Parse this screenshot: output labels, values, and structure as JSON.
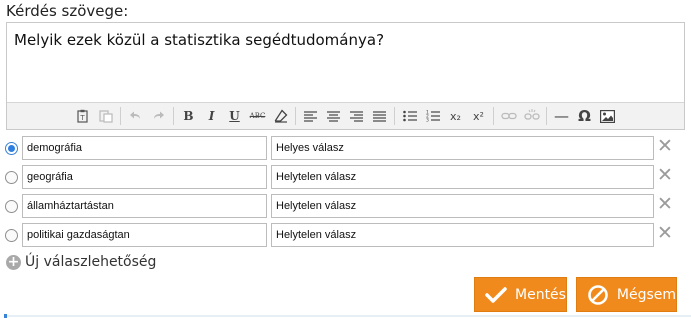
{
  "question": {
    "label": "Kérdés szövege:",
    "text": "Melyik ezek közül a statisztika segédtudománya?"
  },
  "toolbar": {
    "buttons": [
      {
        "name": "paste-text-icon",
        "glyph": "",
        "enabled": true
      },
      {
        "name": "paste-word-icon",
        "glyph": "",
        "enabled": false
      },
      {
        "name": "undo-icon",
        "glyph": "↶",
        "enabled": false
      },
      {
        "name": "redo-icon",
        "glyph": "↷",
        "enabled": false
      },
      {
        "name": "bold-icon",
        "glyph": "B",
        "enabled": true
      },
      {
        "name": "italic-icon",
        "glyph": "I",
        "enabled": true
      },
      {
        "name": "underline-icon",
        "glyph": "U",
        "enabled": true
      },
      {
        "name": "strikethrough-icon",
        "glyph": "ABC",
        "enabled": true
      },
      {
        "name": "eraser-icon",
        "glyph": "",
        "enabled": true
      },
      {
        "name": "align-left-icon",
        "glyph": "",
        "enabled": true
      },
      {
        "name": "align-center-icon",
        "glyph": "",
        "enabled": true
      },
      {
        "name": "align-right-icon",
        "glyph": "",
        "enabled": true
      },
      {
        "name": "align-justify-icon",
        "glyph": "",
        "enabled": true
      },
      {
        "name": "bullet-list-icon",
        "glyph": "",
        "enabled": true
      },
      {
        "name": "numbered-list-icon",
        "glyph": "",
        "enabled": true
      },
      {
        "name": "subscript-icon",
        "glyph": "x₂",
        "enabled": true
      },
      {
        "name": "superscript-icon",
        "glyph": "x²",
        "enabled": true
      },
      {
        "name": "link-icon",
        "glyph": "",
        "enabled": false
      },
      {
        "name": "unlink-icon",
        "glyph": "",
        "enabled": false
      },
      {
        "name": "horizontal-rule-icon",
        "glyph": "—",
        "enabled": true
      },
      {
        "name": "omega-icon",
        "glyph": "Ω",
        "enabled": true
      },
      {
        "name": "image-icon",
        "glyph": "",
        "enabled": true
      }
    ]
  },
  "answers": [
    {
      "text": "demográfia",
      "feedback": "Helyes válasz",
      "selected": true
    },
    {
      "text": "geográfia",
      "feedback": "Helytelen válasz",
      "selected": false
    },
    {
      "text": "államháztartástan",
      "feedback": "Helytelen válasz",
      "selected": false
    },
    {
      "text": "politikai gazdaságtan",
      "feedback": "Helytelen válasz",
      "selected": false
    }
  ],
  "add_option_label": "Új válaszlehetőség",
  "buttons": {
    "save_label": "Mentés",
    "cancel_label": "Mégsem"
  },
  "colors": {
    "accent": "#f18a1c",
    "radio_selected": "#2f7fe0"
  }
}
